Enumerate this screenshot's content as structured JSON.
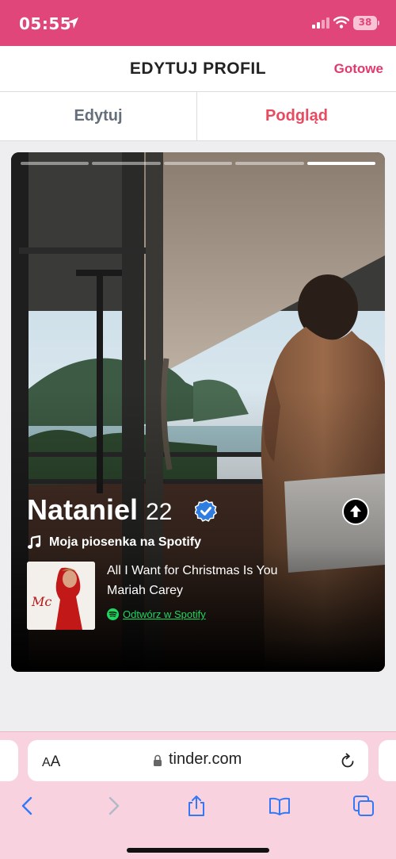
{
  "status": {
    "time": "05:55",
    "battery": "38"
  },
  "header": {
    "title": "EDYTUJ PROFIL",
    "done_label": "Gotowe"
  },
  "tabs": [
    {
      "label": "Edytuj"
    },
    {
      "label": "Podgląd"
    }
  ],
  "profile": {
    "name": "Nataniel",
    "age": "22",
    "photo_count": 5,
    "active_photo": 5,
    "anthem_label": "Moja piosenka na Spotify",
    "song_title": "All I Want for Christmas Is You",
    "song_artist": "Mariah Carey",
    "spotify_link": "Odtwórz w Spotify"
  },
  "browser": {
    "text_size_small": "A",
    "text_size_big": "A",
    "url": "tinder.com"
  },
  "icons": [
    "location-arrow-icon",
    "signal-icon",
    "wifi-icon",
    "battery-icon",
    "verified-icon",
    "info-arrow-icon",
    "music-note-icon",
    "spotify-icon",
    "lock-icon",
    "reload-icon",
    "back-icon",
    "forward-icon",
    "share-icon",
    "bookmarks-icon",
    "tabs-icon"
  ],
  "colors": {
    "status_bar": "#e0467a",
    "accent": "#e03a6e",
    "preview_tab": "#e84a5f",
    "spotify": "#1ed760",
    "verified": "#2f7de1",
    "browser_bar": "#f9d2e0",
    "toolbar_icons": "#3478f6"
  }
}
